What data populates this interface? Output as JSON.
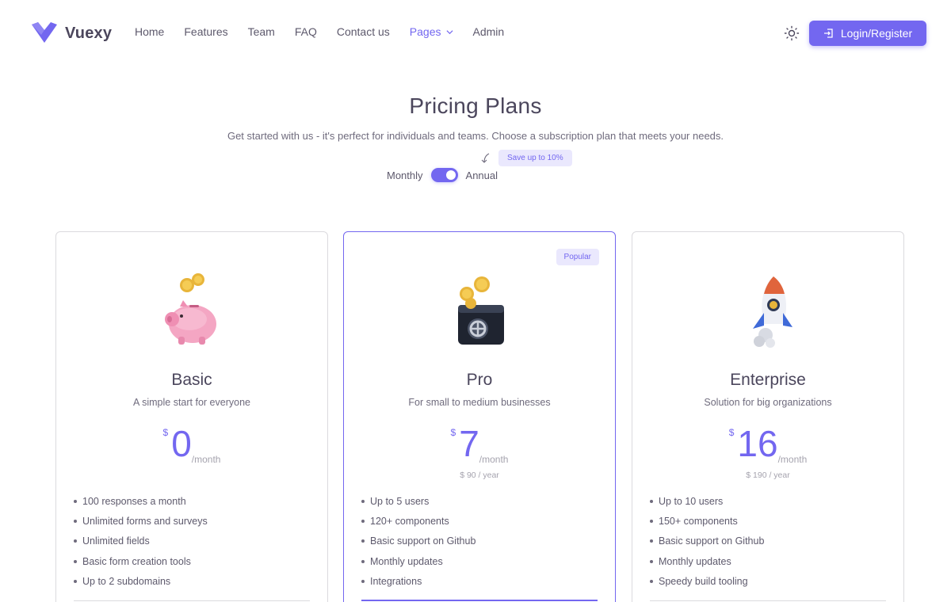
{
  "brand": {
    "name": "Vuexy",
    "color": "#7367f0"
  },
  "nav": {
    "items": [
      {
        "label": "Home",
        "active": false
      },
      {
        "label": "Features",
        "active": false
      },
      {
        "label": "Team",
        "active": false
      },
      {
        "label": "FAQ",
        "active": false
      },
      {
        "label": "Contact us",
        "active": false
      },
      {
        "label": "Pages",
        "active": true,
        "dropdown": true
      },
      {
        "label": "Admin",
        "active": false
      }
    ],
    "theme_icon": "sun-icon",
    "login_label": "Login/Register",
    "login_icon": "login-icon"
  },
  "hero": {
    "title": "Pricing Plans",
    "subtitle": "Get started with us - it's perfect for individuals and teams. Choose a subscription plan that meets your needs.",
    "save_badge": "Save up to 10%",
    "monthly_label": "Monthly",
    "annual_label": "Annual",
    "annual_selected": true
  },
  "plans": [
    {
      "name": "Basic",
      "description": "A simple start for everyone",
      "currency": "$",
      "price": "0",
      "period": "/month",
      "yearly": "",
      "popular": false,
      "illustration": "piggy-bank-icon",
      "features": [
        "100 responses a month",
        "Unlimited forms and surveys",
        "Unlimited fields",
        "Basic form creation tools",
        "Up to 2 subdomains"
      ]
    },
    {
      "name": "Pro",
      "description": "For small to medium businesses",
      "currency": "$",
      "price": "7",
      "period": "/month",
      "yearly": "$ 90 / year",
      "popular": true,
      "popular_label": "Popular",
      "illustration": "safe-box-icon",
      "features": [
        "Up to 5 users",
        "120+ components",
        "Basic support on Github",
        "Monthly updates",
        "Integrations"
      ]
    },
    {
      "name": "Enterprise",
      "description": "Solution for big organizations",
      "currency": "$",
      "price": "16",
      "period": "/month",
      "yearly": "$ 190 / year",
      "popular": false,
      "illustration": "rocket-icon",
      "features": [
        "Up to 10 users",
        "150+ components",
        "Basic support on Github",
        "Monthly updates",
        "Speedy build tooling"
      ]
    }
  ]
}
